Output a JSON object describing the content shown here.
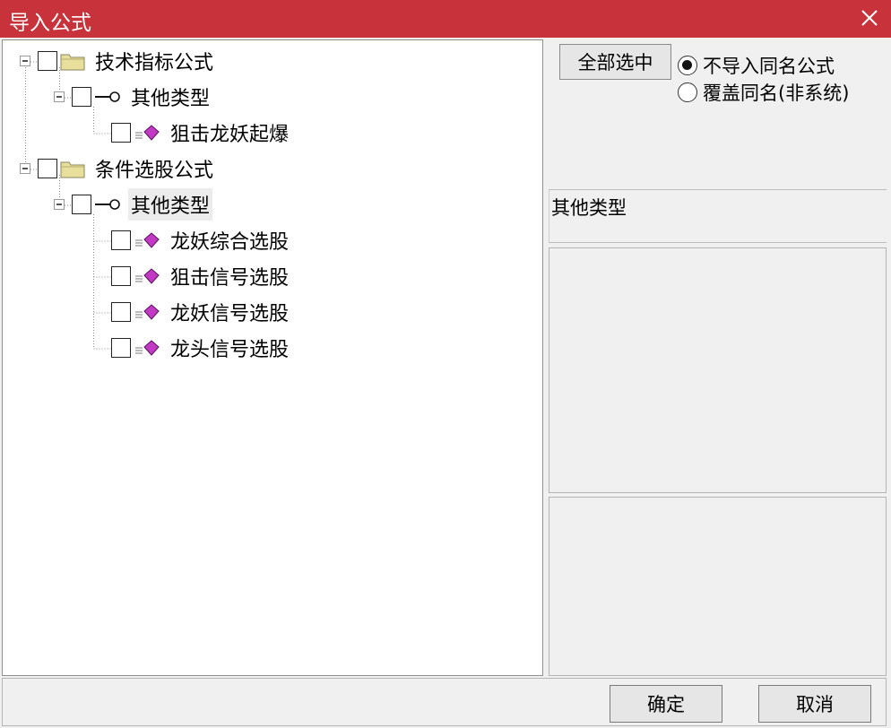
{
  "window": {
    "title": "导入公式"
  },
  "tree": {
    "groups": [
      {
        "label": "技术指标公式",
        "checked": false,
        "subgroups": [
          {
            "label": "其他类型",
            "checked": false,
            "items": [
              {
                "label": "狙击龙妖起爆",
                "checked": false
              }
            ]
          }
        ]
      },
      {
        "label": "条件选股公式",
        "checked": false,
        "subgroups": [
          {
            "label": "其他类型",
            "checked": false,
            "selected": true,
            "items": [
              {
                "label": "龙妖综合选股",
                "checked": false
              },
              {
                "label": "狙击信号选股",
                "checked": false
              },
              {
                "label": "龙妖信号选股",
                "checked": false
              },
              {
                "label": "龙头信号选股",
                "checked": false
              }
            ]
          }
        ]
      }
    ]
  },
  "options": {
    "select_all_label": "全部选中",
    "radios": [
      {
        "label": "不导入同名公式",
        "checked": true
      },
      {
        "label": "覆盖同名(非系统)",
        "checked": false
      }
    ]
  },
  "description": {
    "text": "其他类型"
  },
  "buttons": {
    "ok_label": "确定",
    "cancel_label": "取消"
  },
  "colors": {
    "titlebar": "#c8333b",
    "formula_icon": "#c23ac4",
    "folder_icon": "#e8df9c"
  },
  "icons": {
    "group": "folder-icon",
    "subgroup": "key-icon",
    "item": "formula-icon",
    "close": "close-icon"
  }
}
